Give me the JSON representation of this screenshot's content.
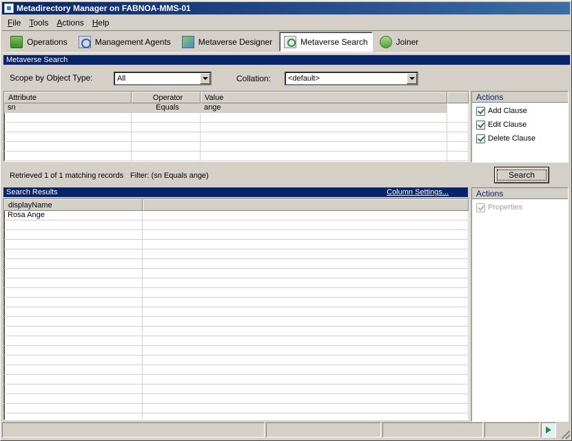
{
  "window": {
    "title": "Metadirectory Manager on FABNOA-MMS-01"
  },
  "menu": [
    {
      "label": "File",
      "accel": "F",
      "rest": "ile"
    },
    {
      "label": "Tools",
      "accel": "T",
      "rest": "ools"
    },
    {
      "label": "Actions",
      "accel": "A",
      "rest": "ctions"
    },
    {
      "label": "Help",
      "accel": "H",
      "rest": "elp"
    }
  ],
  "toolbar": {
    "operations": "Operations",
    "management_agents": "Management Agents",
    "metaverse_designer": "Metaverse Designer",
    "metaverse_search": "Metaverse Search",
    "joiner": "Joiner"
  },
  "metaverse_search": {
    "header": "Metaverse Search",
    "scope_label": "Scope by Object Type:",
    "scope_value": "All",
    "collation_label": "Collation:",
    "collation_value": "<default>"
  },
  "clause_table": {
    "headers": [
      "Attribute",
      "Operator",
      "Value"
    ],
    "rows": [
      {
        "attribute": "sn",
        "operator": "Equals",
        "value": "ange"
      }
    ]
  },
  "clause_actions": {
    "header": "Actions",
    "items": [
      "Add Clause",
      "Edit Clause",
      "Delete Clause"
    ]
  },
  "status": {
    "retrieved": "Retrieved 1 of 1 matching records",
    "filter": "Filter: (sn Equals ange)"
  },
  "search_button": "Search",
  "results": {
    "header": "Search Results",
    "column_settings": "Column Settings...",
    "columns": [
      "displayName"
    ],
    "rows": [
      "Rosa Ange"
    ]
  },
  "result_actions": {
    "header": "Actions",
    "items": [
      "Properties"
    ]
  }
}
